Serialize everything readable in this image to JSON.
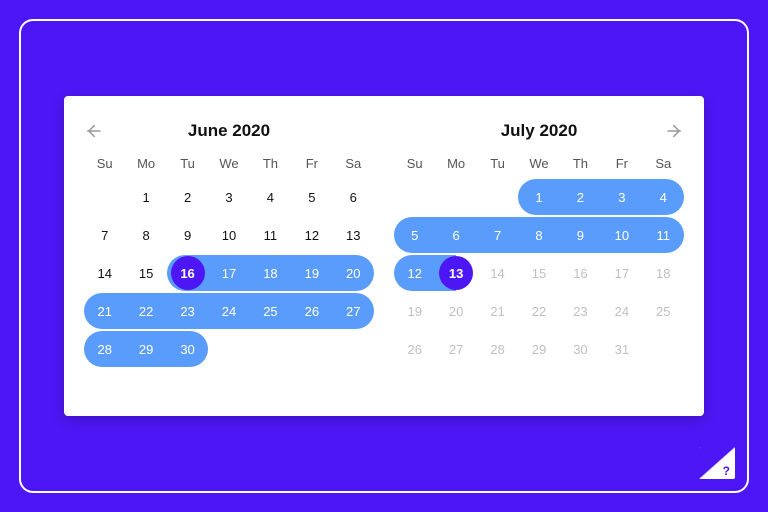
{
  "colors": {
    "brand": "#4d16f5",
    "range": "#5a9cfb"
  },
  "dow": [
    "Su",
    "Mo",
    "Tu",
    "We",
    "Th",
    "Fr",
    "Sa"
  ],
  "months": [
    {
      "title": "June 2020",
      "nav": "prev",
      "weeks": [
        [
          {
            "v": ""
          },
          {
            "v": "1"
          },
          {
            "v": "2"
          },
          {
            "v": "3"
          },
          {
            "v": "4"
          },
          {
            "v": "5"
          },
          {
            "v": "6"
          }
        ],
        [
          {
            "v": "7"
          },
          {
            "v": "8"
          },
          {
            "v": "9"
          },
          {
            "v": "10"
          },
          {
            "v": "11"
          },
          {
            "v": "12"
          },
          {
            "v": "13"
          }
        ],
        [
          {
            "v": "14"
          },
          {
            "v": "15"
          },
          {
            "v": "16",
            "anchorStart": true
          },
          {
            "v": "17",
            "sel": true
          },
          {
            "v": "18",
            "sel": true
          },
          {
            "v": "19",
            "sel": true
          },
          {
            "v": "20",
            "sel": true,
            "rEnd": true
          }
        ],
        [
          {
            "v": "21",
            "sel": true,
            "rStart": true
          },
          {
            "v": "22",
            "sel": true
          },
          {
            "v": "23",
            "sel": true
          },
          {
            "v": "24",
            "sel": true
          },
          {
            "v": "25",
            "sel": true
          },
          {
            "v": "26",
            "sel": true
          },
          {
            "v": "27",
            "sel": true,
            "rEnd": true
          }
        ],
        [
          {
            "v": "28",
            "sel": true,
            "rStart": true
          },
          {
            "v": "29",
            "sel": true
          },
          {
            "v": "30",
            "sel": true,
            "rEnd": true
          },
          {
            "v": ""
          },
          {
            "v": ""
          },
          {
            "v": ""
          },
          {
            "v": ""
          }
        ]
      ]
    },
    {
      "title": "July 2020",
      "nav": "next",
      "weeks": [
        [
          {
            "v": ""
          },
          {
            "v": ""
          },
          {
            "v": ""
          },
          {
            "v": "1",
            "sel": true,
            "rStart": true
          },
          {
            "v": "2",
            "sel": true
          },
          {
            "v": "3",
            "sel": true
          },
          {
            "v": "4",
            "sel": true,
            "rEnd": true
          }
        ],
        [
          {
            "v": "5",
            "sel": true,
            "rStart": true
          },
          {
            "v": "6",
            "sel": true
          },
          {
            "v": "7",
            "sel": true
          },
          {
            "v": "8",
            "sel": true
          },
          {
            "v": "9",
            "sel": true
          },
          {
            "v": "10",
            "sel": true
          },
          {
            "v": "11",
            "sel": true,
            "rEnd": true
          }
        ],
        [
          {
            "v": "12",
            "sel": true,
            "rStart": true
          },
          {
            "v": "13",
            "anchorEnd": true
          },
          {
            "v": "14",
            "inactive": true
          },
          {
            "v": "15",
            "inactive": true
          },
          {
            "v": "16",
            "inactive": true
          },
          {
            "v": "17",
            "inactive": true
          },
          {
            "v": "18",
            "inactive": true
          }
        ],
        [
          {
            "v": "19",
            "inactive": true
          },
          {
            "v": "20",
            "inactive": true
          },
          {
            "v": "21",
            "inactive": true
          },
          {
            "v": "22",
            "inactive": true
          },
          {
            "v": "23",
            "inactive": true
          },
          {
            "v": "24",
            "inactive": true
          },
          {
            "v": "25",
            "inactive": true
          }
        ],
        [
          {
            "v": "26",
            "inactive": true
          },
          {
            "v": "27",
            "inactive": true
          },
          {
            "v": "28",
            "inactive": true
          },
          {
            "v": "29",
            "inactive": true
          },
          {
            "v": "30",
            "inactive": true
          },
          {
            "v": "31",
            "inactive": true
          },
          {
            "v": ""
          }
        ]
      ]
    }
  ],
  "help": {
    "label": "?"
  }
}
